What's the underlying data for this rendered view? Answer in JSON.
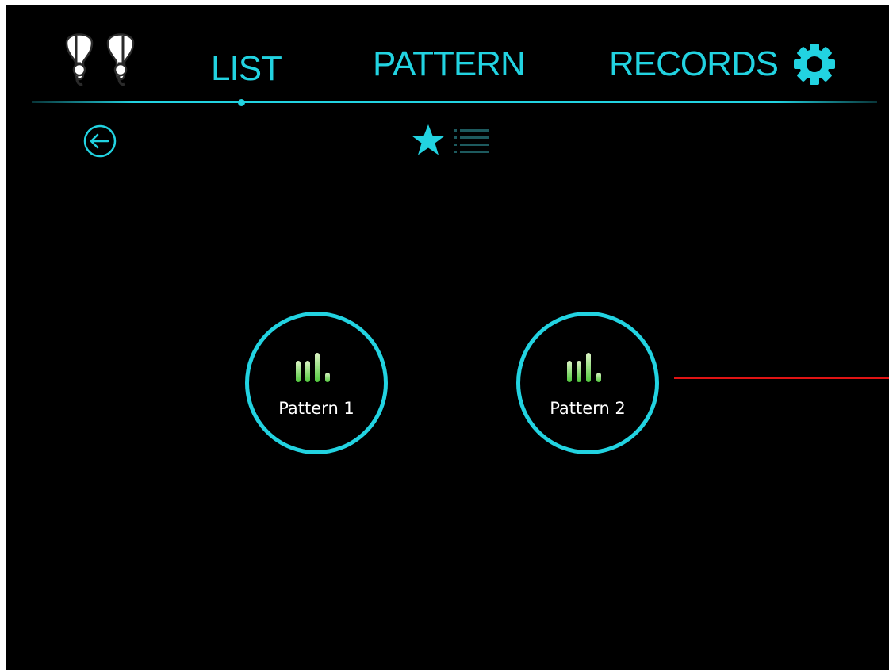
{
  "nav": {
    "tabs": [
      {
        "label": "LIST"
      },
      {
        "label": "PATTERN"
      },
      {
        "label": "RECORDS"
      }
    ],
    "active_tab": "LIST",
    "device_icon": "earbuds-icon",
    "settings_icon": "gear-icon"
  },
  "toolbar": {
    "back_icon": "arrow-left-circle-icon",
    "favorites_icon": "star-icon",
    "list_icon": "list-icon",
    "selected_view": "favorites"
  },
  "patterns": [
    {
      "label": "Pattern 1",
      "icon": "signal-bars-icon"
    },
    {
      "label": "Pattern 2",
      "icon": "signal-bars-icon"
    }
  ],
  "colors": {
    "accent": "#22d3e1",
    "background": "#000000",
    "bars_light": "#dff5c8",
    "bars_dark": "#4fc73b",
    "marker": "#e01414"
  }
}
